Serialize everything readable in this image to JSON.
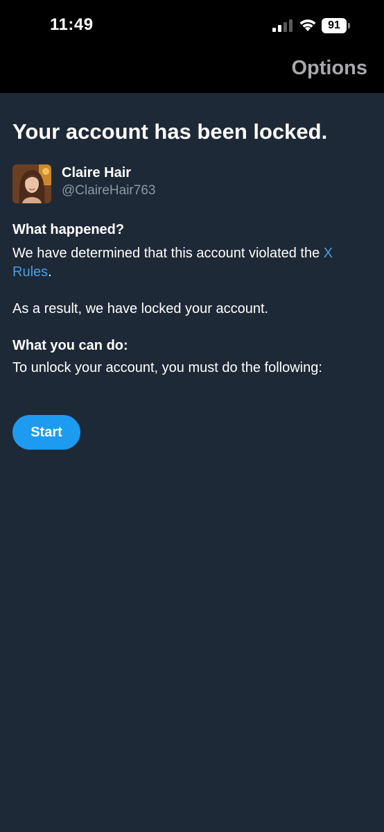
{
  "status_bar": {
    "time": "11:49",
    "battery": "91",
    "signal_icon": "cellular-signal-icon",
    "wifi_icon": "wifi-icon",
    "battery_icon": "battery-icon"
  },
  "header": {
    "options_label": "Options"
  },
  "main": {
    "headline": "Your account has been locked.",
    "profile": {
      "name": "Claire Hair",
      "handle": "@ClaireHair763"
    },
    "what_happened": {
      "heading": "What happened?",
      "text_before_link": "We have determined that this account violated the ",
      "link_text": "X Rules",
      "text_after_link": ".",
      "result_text": "As a result, we have locked your account."
    },
    "what_you_can_do": {
      "heading": "What you can do:",
      "text": "To unlock your account, you must do the following:"
    },
    "start_button_label": "Start"
  },
  "colors": {
    "page_bg": "#1e2937",
    "topbar_bg": "#000000",
    "accent": "#1d9bf0",
    "link": "#4a9ee0",
    "muted_text": "#8b98a5",
    "options_text": "#a8a8ad"
  }
}
